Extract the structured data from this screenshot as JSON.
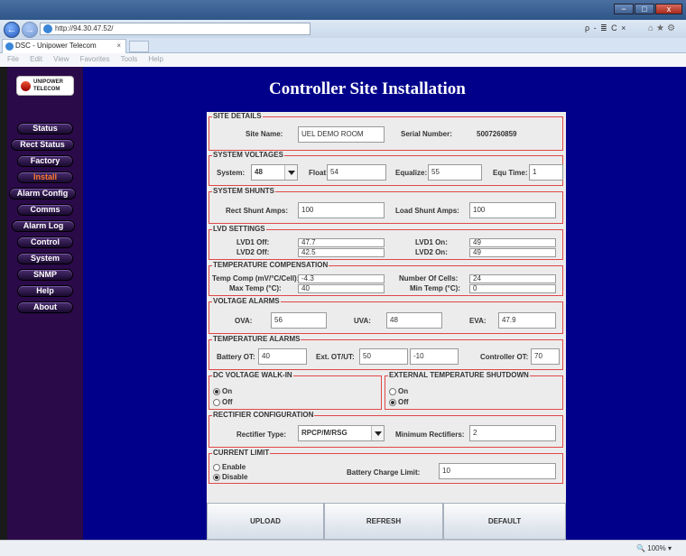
{
  "browser": {
    "url": "http://94.30.47.52/",
    "tab_title": "DSC - Unipower Telecom",
    "tab_close": "×",
    "menu": [
      "File",
      "Edit",
      "View",
      "Favorites",
      "Tools",
      "Help"
    ],
    "search_tools": "ρ - ≣ C ×",
    "zoom": "100%",
    "window_controls": [
      "−",
      "□",
      "x"
    ]
  },
  "logo": {
    "line1": "UNIPOWER",
    "line2": "TELECOM"
  },
  "nav": [
    {
      "label": "Status",
      "active": false
    },
    {
      "label": "Rect Status",
      "active": false
    },
    {
      "label": "Factory",
      "active": false
    },
    {
      "label": "Install",
      "active": true
    },
    {
      "label": "Alarm Config",
      "active": false
    },
    {
      "label": "Comms",
      "active": false
    },
    {
      "label": "Alarm Log",
      "active": false
    },
    {
      "label": "Control",
      "active": false
    },
    {
      "label": "System",
      "active": false
    },
    {
      "label": "SNMP",
      "active": false
    },
    {
      "label": "Help",
      "active": false
    },
    {
      "label": "About",
      "active": false
    }
  ],
  "page_title": "Controller Site Installation",
  "site": {
    "legend": "SITE DETAILS",
    "name_label": "Site Name:",
    "name": "UEL DEMO ROOM",
    "serial_label": "Serial Number:",
    "serial": "5007260859"
  },
  "voltages": {
    "legend": "SYSTEM VOLTAGES",
    "system_label": "System:",
    "system": "48",
    "float_label": "Float:",
    "float": "54",
    "equalize_label": "Equalize:",
    "equalize": "55",
    "equtime_label": "Equ Time:",
    "equtime": "1"
  },
  "shunts": {
    "legend": "SYSTEM SHUNTS",
    "rect_label": "Rect Shunt Amps:",
    "rect": "100",
    "load_label": "Load Shunt Amps:",
    "load": "100"
  },
  "lvd": {
    "legend": "LVD SETTINGS",
    "lvd1off_label": "LVD1 Off:",
    "lvd1off": "47.7",
    "lvd1on_label": "LVD1 On:",
    "lvd1on": "49",
    "lvd2off_label": "LVD2 Off:",
    "lvd2off": "42.5",
    "lvd2on_label": "LVD2 On:",
    "lvd2on": "49"
  },
  "tempcomp": {
    "legend": "TEMPERATURE COMPENSATION",
    "comp_label": "Temp Comp (mV/°C/Cell):",
    "comp": "-4.3",
    "cells_label": "Number Of Cells:",
    "cells": "24",
    "max_label": "Max Temp (°C):",
    "max": "40",
    "min_label": "Min Temp (°C):",
    "min": "0"
  },
  "valarms": {
    "legend": "VOLTAGE ALARMS",
    "ova_label": "OVA:",
    "ova": "56",
    "uva_label": "UVA:",
    "uva": "48",
    "eva_label": "EVA:",
    "eva": "47.9"
  },
  "talarms": {
    "legend": "TEMPERATURE ALARMS",
    "batt_label": "Battery OT:",
    "batt": "40",
    "ext_label": "Ext. OT/UT:",
    "ext_ot": "50",
    "ext_ut": "-10",
    "ctrl_label": "Controller OT:",
    "ctrl": "70"
  },
  "walkin": {
    "legend": "DC VOLTAGE WALK-IN",
    "on": "On",
    "off": "Off",
    "selected": "On"
  },
  "extshut": {
    "legend": "EXTERNAL TEMPERATURE SHUTDOWN",
    "on": "On",
    "off": "Off",
    "selected": "Off"
  },
  "rectcfg": {
    "legend": "RECTIFIER CONFIGURATION",
    "type_label": "Rectifier Type:",
    "type": "RPCP/M/RSG",
    "min_label": "Minimum Rectifiers:",
    "min": "2"
  },
  "climit": {
    "legend": "CURRENT LIMIT",
    "enable": "Enable",
    "disable": "Disable",
    "selected": "Disable",
    "batt_label": "Battery Charge Limit:",
    "batt": "10"
  },
  "buttons": {
    "upload": "UPLOAD",
    "refresh": "REFRESH",
    "default": "DEFAULT"
  }
}
